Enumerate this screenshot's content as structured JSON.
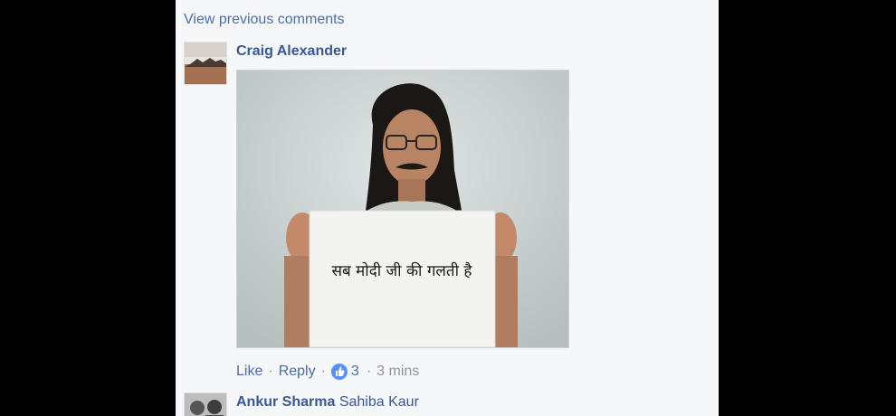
{
  "comments_panel": {
    "view_previous_label": "View previous comments",
    "comment": {
      "author": "Craig Alexander",
      "image_caption_text": "सब मोदी जी की गलती है",
      "actions": {
        "like_label": "Like",
        "reply_label": "Reply",
        "separator": "·",
        "reaction_icon": "like-thumbs-up-icon",
        "reaction_count": "3",
        "timestamp": "3 mins"
      }
    },
    "reply": {
      "author": "Ankur Sharma",
      "text": "Sahiba Kaur"
    }
  },
  "colors": {
    "link": "#4b6eaa",
    "author": "#365899",
    "panel_bg": "#f6f7f9",
    "outer_bg": "#000000",
    "like_badge": "#5890ff"
  }
}
